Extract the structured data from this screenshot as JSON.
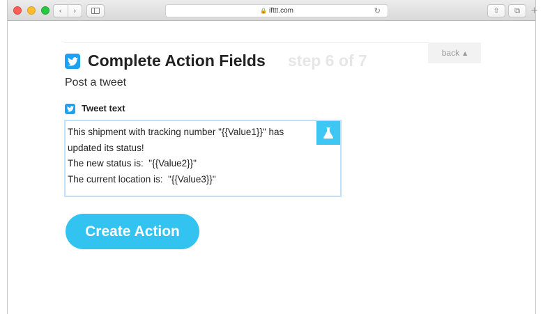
{
  "browser": {
    "url": "ifttt.com",
    "nav_back": "‹",
    "nav_forward": "›",
    "reload": "↻",
    "lock": "🔒",
    "new_tab": "+",
    "share": "⇧",
    "tabs": "⧉"
  },
  "header": {
    "back_label": "back",
    "back_arrow": "▲",
    "title": "Complete Action Fields",
    "step": "step 6 of 7",
    "subtitle": "Post a tweet"
  },
  "field": {
    "label": "Tweet text",
    "lines": [
      "This shipment with tracking number \"{{Value1}}\" has",
      "updated its status!",
      "The new status is:  \"{{Value2}}\"",
      "The current location is:  \"{{Value3}}\""
    ]
  },
  "actions": {
    "create_label": "Create Action"
  },
  "colors": {
    "accent": "#33c3f0",
    "twitter": "#1da1f2",
    "field_border": "#bfe0f6"
  },
  "icons": {
    "service": "twitter-icon",
    "ingredient": "flask-icon"
  }
}
